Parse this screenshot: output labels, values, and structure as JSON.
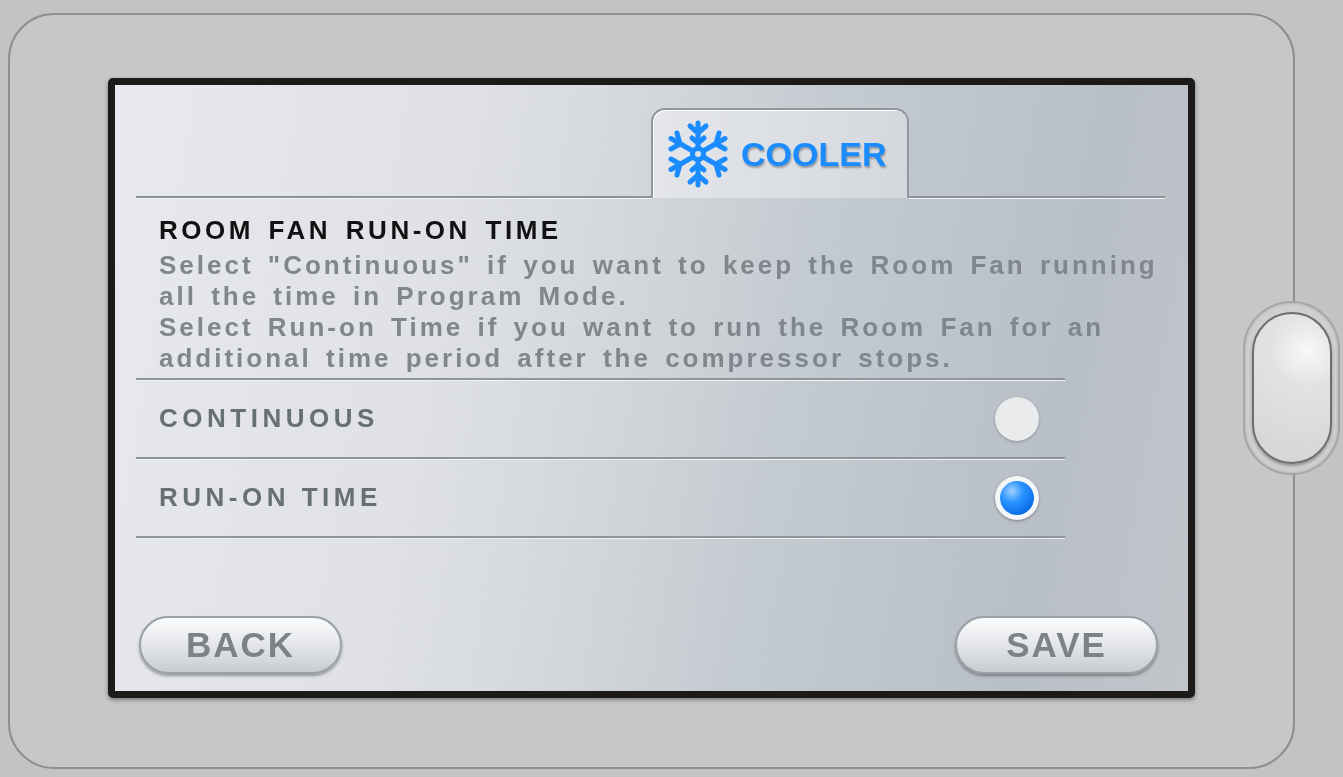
{
  "screen": {
    "tabs": [
      {
        "label": "COOLER",
        "selected": true
      }
    ],
    "title": "ROOM FAN RUN-ON TIME",
    "description": [
      "Select \"Continuous\" if you want to keep the Room Fan running all the time in Program Mode.",
      "Select Run-on Time if you want to run the Room Fan for an additional time period after the compressor stops."
    ],
    "options": [
      {
        "label": "CONTINUOUS",
        "selected": false
      },
      {
        "label": "RUN-ON TIME",
        "selected": true
      }
    ],
    "buttons": [
      "BACK",
      "SAVE"
    ]
  }
}
